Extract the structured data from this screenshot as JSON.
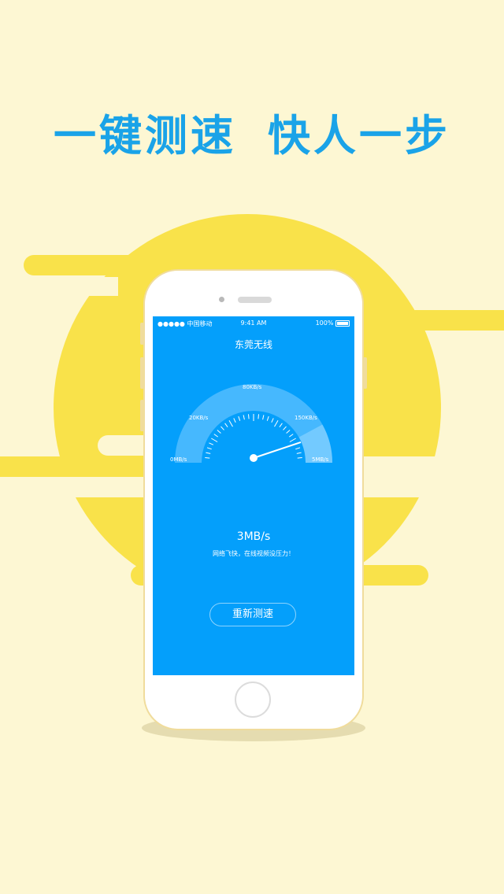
{
  "headline": {
    "part1": "一键测速",
    "part2": "快人一步"
  },
  "status_bar": {
    "signal": "●●●●● 中国移动",
    "time": "9:41 AM",
    "battery": "100%"
  },
  "screen": {
    "title": "东莞无线",
    "gauge": {
      "labels": [
        "0MB/s",
        "20KB/s",
        "80KB/s",
        "150KB/s",
        "5MB/s"
      ]
    },
    "speed": "3MB/s",
    "message": "网络飞快，在线视频没压力！",
    "retest_button": "重新测速"
  },
  "colors": {
    "background": "#fdf7d3",
    "sun": "#f9e24a",
    "screen": "#049ffb",
    "headline": "#1aa3e8"
  }
}
